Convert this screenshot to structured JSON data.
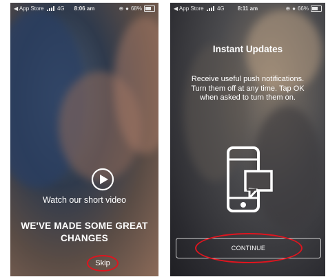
{
  "screen1": {
    "status": {
      "carrier": "◀ App Store",
      "network": "4G",
      "time": "8:06 am",
      "battery_text": "68%",
      "battery_level": 0.68
    },
    "watch_video": "Watch our short video",
    "headline": "WE'VE MADE SOME GREAT CHANGES",
    "skip": "Skip",
    "play_icon": "play-circle-icon"
  },
  "screen2": {
    "status": {
      "carrier": "◀ App Store",
      "network": "4G",
      "time": "8:11 am",
      "battery_text": "66%",
      "battery_level": 0.66
    },
    "title": "Instant Updates",
    "description": "Receive useful push notifications. Turn them off at any time. Tap OK when asked to turn them on.",
    "continue": "CONTINUE",
    "phone_icon": "phone-message-icon"
  },
  "colors": {
    "highlight": "#e0141e",
    "text": "#ffffff"
  }
}
